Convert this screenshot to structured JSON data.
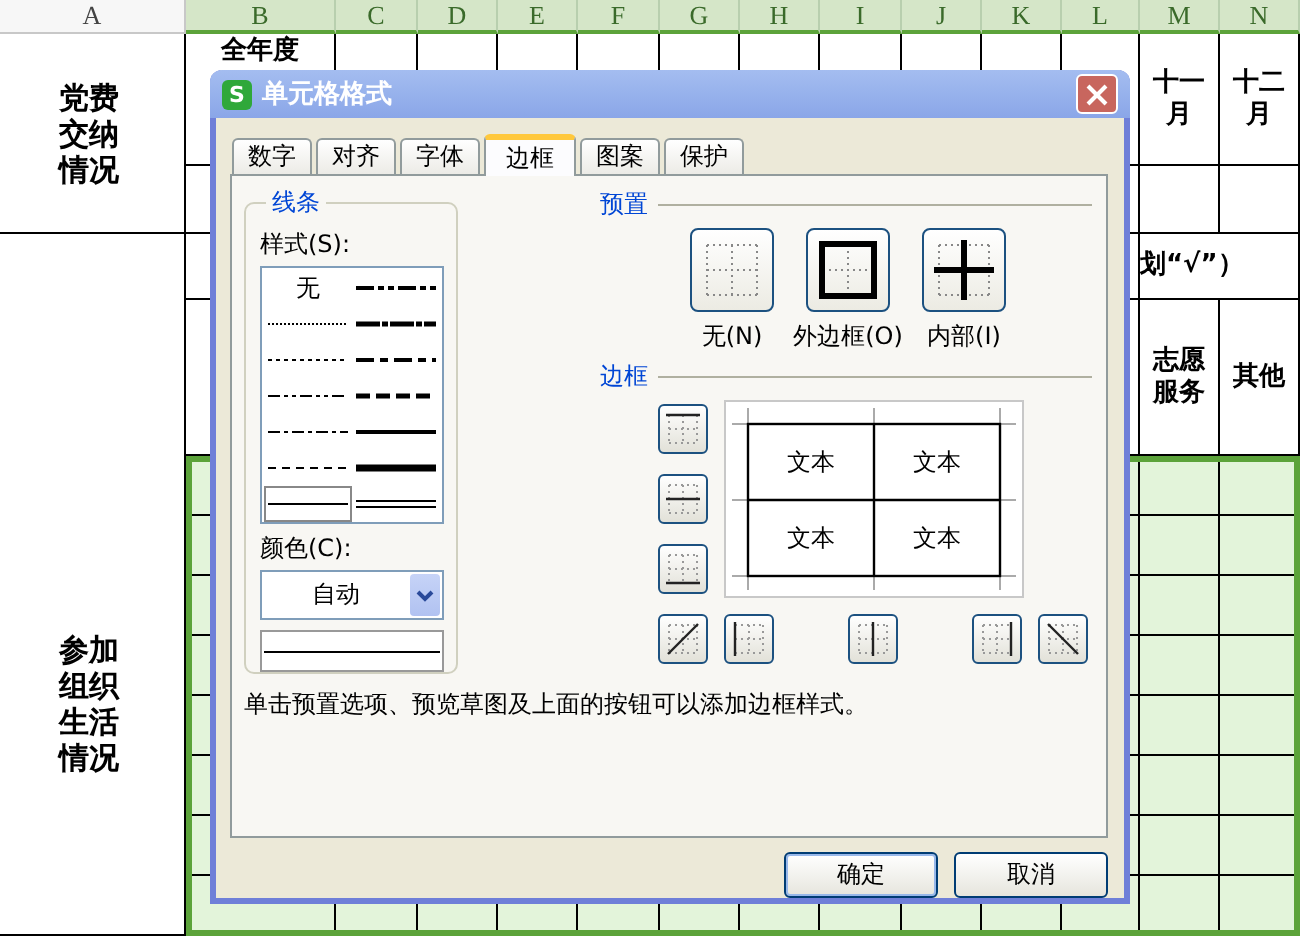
{
  "sheet": {
    "columns": [
      {
        "label": "A",
        "selected": false
      },
      {
        "label": "B",
        "selected": true
      },
      {
        "label": "C",
        "selected": true
      },
      {
        "label": "D",
        "selected": true
      },
      {
        "label": "E",
        "selected": true
      },
      {
        "label": "F",
        "selected": true
      },
      {
        "label": "G",
        "selected": true
      },
      {
        "label": "H",
        "selected": true
      },
      {
        "label": "I",
        "selected": true
      },
      {
        "label": "J",
        "selected": true
      },
      {
        "label": "K",
        "selected": true
      },
      {
        "label": "L",
        "selected": true
      },
      {
        "label": "M",
        "selected": true
      },
      {
        "label": "N",
        "selected": true
      }
    ],
    "fee_section_label": "党费交纳情况",
    "year_header": "全年度",
    "month_headers": [
      "十一月",
      "十二月"
    ],
    "mark_hint": "划“√”）",
    "activity_headers": [
      "志愿服务",
      "其他"
    ],
    "life_section_label": "参加组织生活情况"
  },
  "dialog": {
    "icon_text": "S",
    "title": "单元格格式",
    "tabs": [
      {
        "label": "数字",
        "selected": false
      },
      {
        "label": "对齐",
        "selected": false
      },
      {
        "label": "字体",
        "selected": false
      },
      {
        "label": "边框",
        "selected": true
      },
      {
        "label": "图案",
        "selected": false
      },
      {
        "label": "保护",
        "selected": false
      }
    ],
    "line_group": {
      "title": "线条",
      "style_label": "样式(S):",
      "styles": [
        {
          "kind": "none",
          "label": "无",
          "selected": false
        },
        {
          "kind": "medium-dash-dot-dot",
          "selected": false
        },
        {
          "kind": "hair",
          "selected": false
        },
        {
          "kind": "slanted-dash-dot",
          "selected": false
        },
        {
          "kind": "dotted",
          "selected": false
        },
        {
          "kind": "medium-dash-dot",
          "selected": false
        },
        {
          "kind": "dash-dot-dot",
          "selected": false
        },
        {
          "kind": "medium-dashed",
          "selected": false
        },
        {
          "kind": "dash-dot",
          "selected": false
        },
        {
          "kind": "medium",
          "selected": false
        },
        {
          "kind": "dashed",
          "selected": false
        },
        {
          "kind": "thick",
          "selected": false
        },
        {
          "kind": "thin",
          "selected": true
        },
        {
          "kind": "double",
          "selected": false
        }
      ],
      "color_label": "颜色(C):",
      "color_value": "自动"
    },
    "preset_title": "预置",
    "presets": [
      {
        "kind": "none",
        "label": "无(N)"
      },
      {
        "kind": "outline",
        "label": "外边框(O)"
      },
      {
        "kind": "inside",
        "label": "内部(I)"
      }
    ],
    "border_title": "边框",
    "border_buttons": [
      {
        "kind": "top"
      },
      {
        "kind": "middle"
      },
      {
        "kind": "bottom"
      },
      {
        "kind": "diagonal-up"
      },
      {
        "kind": "left"
      },
      {
        "kind": "center"
      },
      {
        "kind": "right"
      },
      {
        "kind": "diagonal-down"
      }
    ],
    "preview_texts": [
      "文本",
      "文本",
      "文本",
      "文本"
    ],
    "hint": "单击预置选项、预览草图及上面的按钮可以添加边框样式。",
    "buttons": [
      "确定",
      "取消"
    ]
  }
}
